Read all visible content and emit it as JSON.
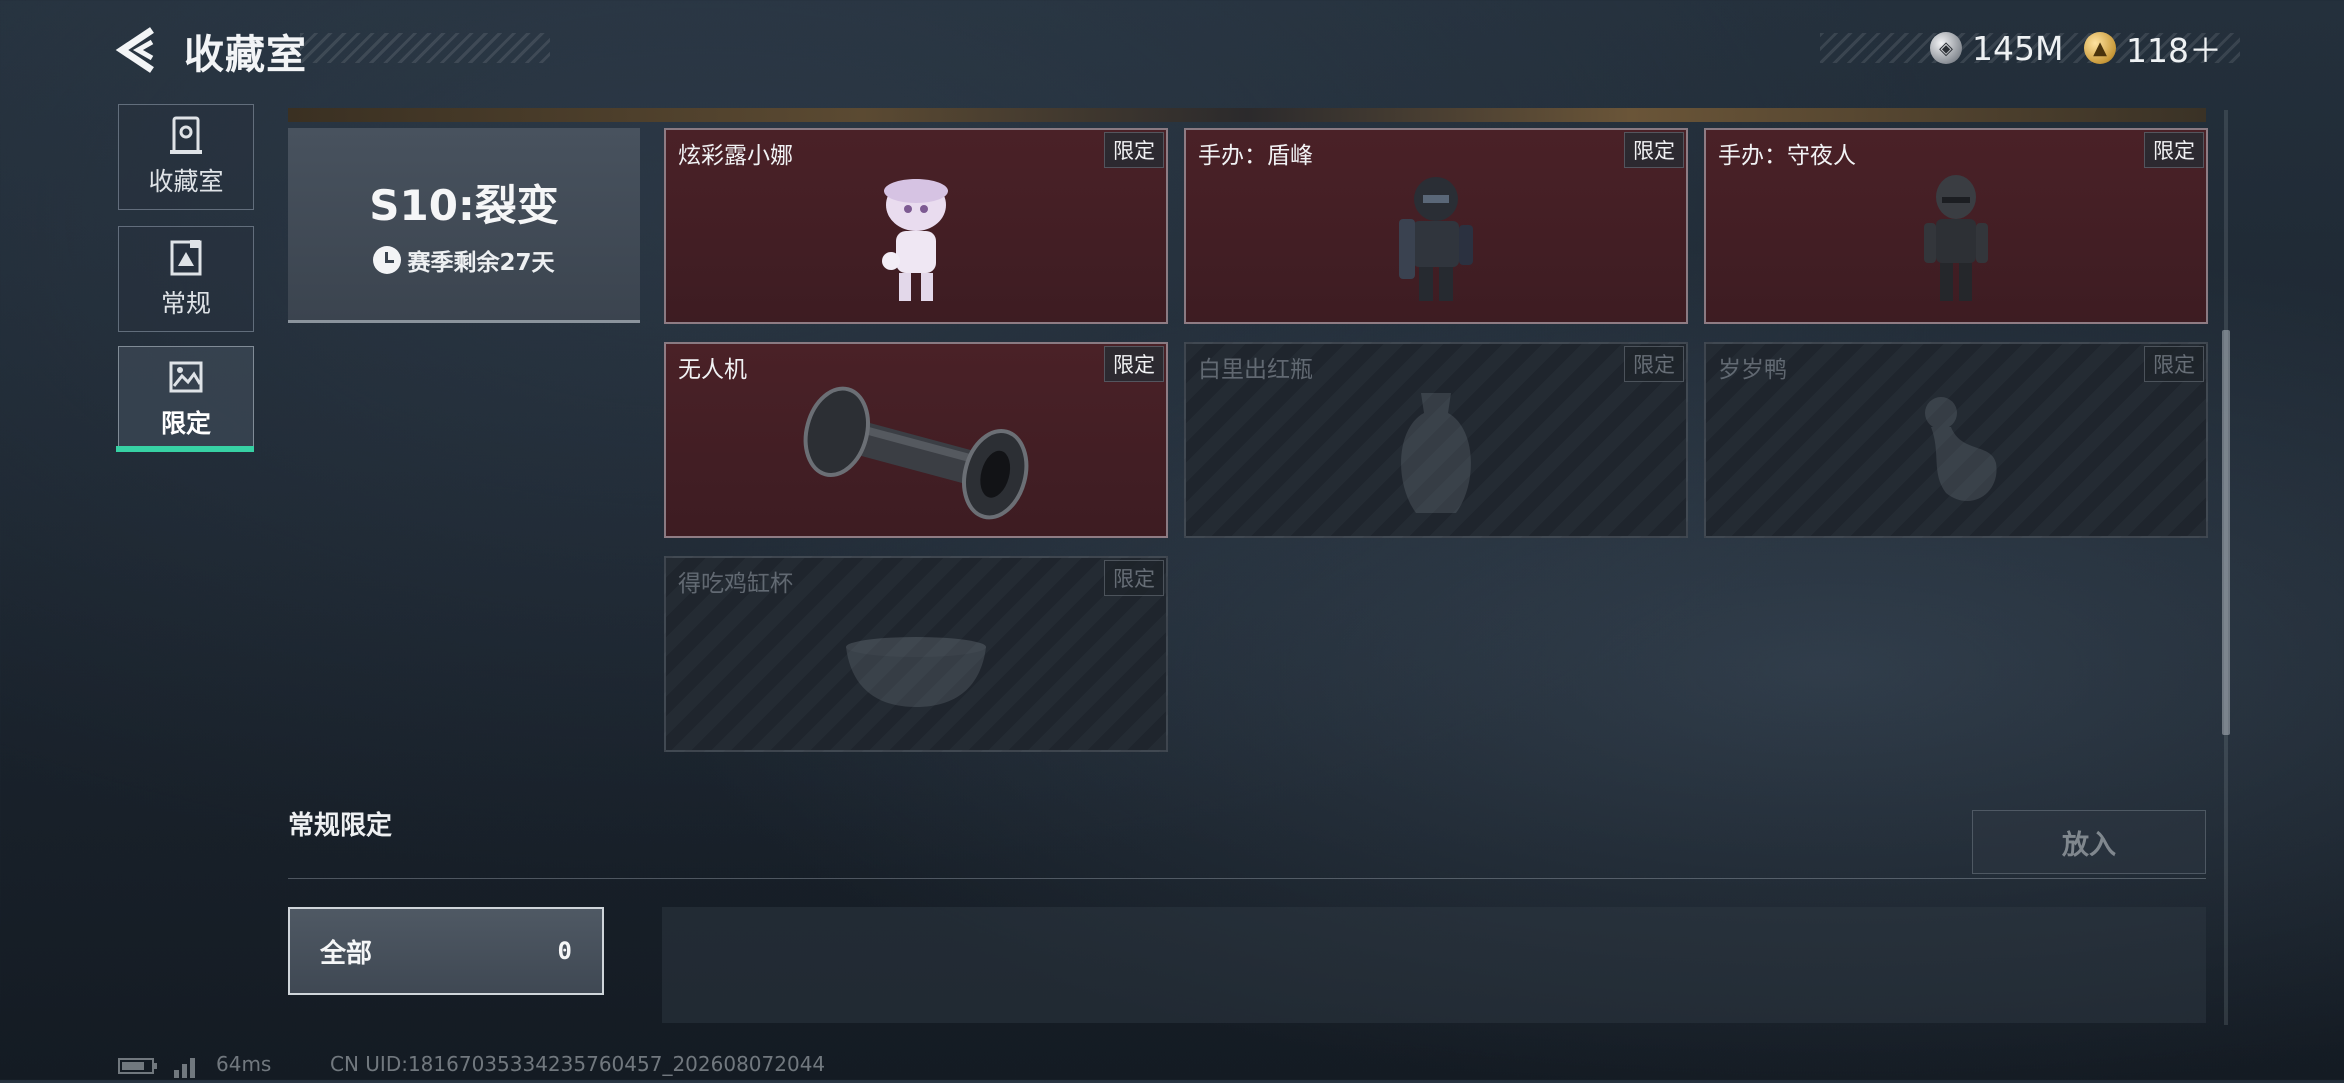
{
  "header": {
    "title": "收藏室",
    "currencies": [
      {
        "icon": "silver-coin-icon",
        "value": "145M"
      },
      {
        "icon": "gold-coin-icon",
        "value": "118＋"
      }
    ]
  },
  "sidebar": {
    "items": [
      {
        "label": "收藏室",
        "icon": "vault-icon",
        "active": false
      },
      {
        "label": "常规",
        "icon": "document-icon",
        "active": false
      },
      {
        "label": "限定",
        "icon": "picture-icon",
        "active": true
      }
    ]
  },
  "season": {
    "title": "S10:裂变",
    "remaining": "赛季剩余27天"
  },
  "items": [
    {
      "name": "炫彩露小娜",
      "tag": "限定",
      "state": "owned",
      "art": "doll-figure-icon"
    },
    {
      "name": "手办：盾峰",
      "tag": "限定",
      "state": "owned",
      "art": "armored-figure-icon"
    },
    {
      "name": "手办：守夜人",
      "tag": "限定",
      "state": "owned",
      "art": "dark-figure-icon"
    },
    {
      "name": "无人机",
      "tag": "限定",
      "state": "owned",
      "art": "drone-roller-icon"
    },
    {
      "name": "白里出红瓶",
      "tag": "限定",
      "state": "locked",
      "art": "vase-icon"
    },
    {
      "name": "岁岁鸭",
      "tag": "限定",
      "state": "locked",
      "art": "duck-icon"
    },
    {
      "name": "得吃鸡缸杯",
      "tag": "限定",
      "state": "locked",
      "art": "bowl-icon"
    }
  ],
  "section": {
    "title": "常规限定",
    "put_button": "放入",
    "filter": {
      "label": "全部",
      "count": "0"
    }
  },
  "status_bar": {
    "ping": "64ms",
    "uid": "CN UID:18167035334235760457_202608072044"
  },
  "colors": {
    "accent": "#37d1a4",
    "owned_card": "#4a2127"
  }
}
